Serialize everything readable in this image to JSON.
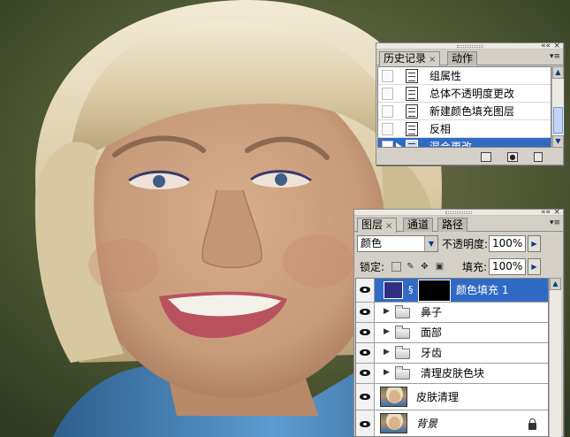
{
  "history_panel": {
    "tabs": [
      {
        "label": "历史记录",
        "active": true
      },
      {
        "label": "动作",
        "active": false
      }
    ],
    "close_glyph": "×",
    "items": [
      {
        "label": "组属性",
        "selected": false
      },
      {
        "label": "总体不透明度更改",
        "selected": false
      },
      {
        "label": "新建颜色填充图层",
        "selected": false
      },
      {
        "label": "反相",
        "selected": false
      },
      {
        "label": "混合更改",
        "selected": true
      }
    ],
    "footer_icons": [
      "new-document-from-state-icon",
      "snapshot-camera-icon",
      "trash-icon"
    ]
  },
  "layers_panel": {
    "tabs": [
      {
        "label": "图层",
        "active": true
      },
      {
        "label": "通道",
        "active": false
      },
      {
        "label": "路径",
        "active": false
      }
    ],
    "close_glyph": "×",
    "blend_mode": "颜色",
    "opacity_label": "不透明度:",
    "opacity_value": "100%",
    "lock_label": "锁定:",
    "fill_label": "填充:",
    "fill_value": "100%",
    "layers": [
      {
        "name": "颜色填充 1",
        "kind": "fill",
        "selected": true,
        "fill_color": "#2e2f7e"
      },
      {
        "name": "鼻子",
        "kind": "group",
        "selected": false
      },
      {
        "name": "面部",
        "kind": "group",
        "selected": false
      },
      {
        "name": "牙齿",
        "kind": "group",
        "selected": false
      },
      {
        "name": "清理皮肤色块",
        "kind": "group",
        "selected": false
      },
      {
        "name": "皮肤清理",
        "kind": "image",
        "selected": false
      },
      {
        "name": "背景",
        "kind": "image",
        "selected": false,
        "italic": true,
        "locked": true
      }
    ]
  },
  "colors": {
    "panel_bg": "#d4d0c8",
    "selection": "#316ac5"
  }
}
